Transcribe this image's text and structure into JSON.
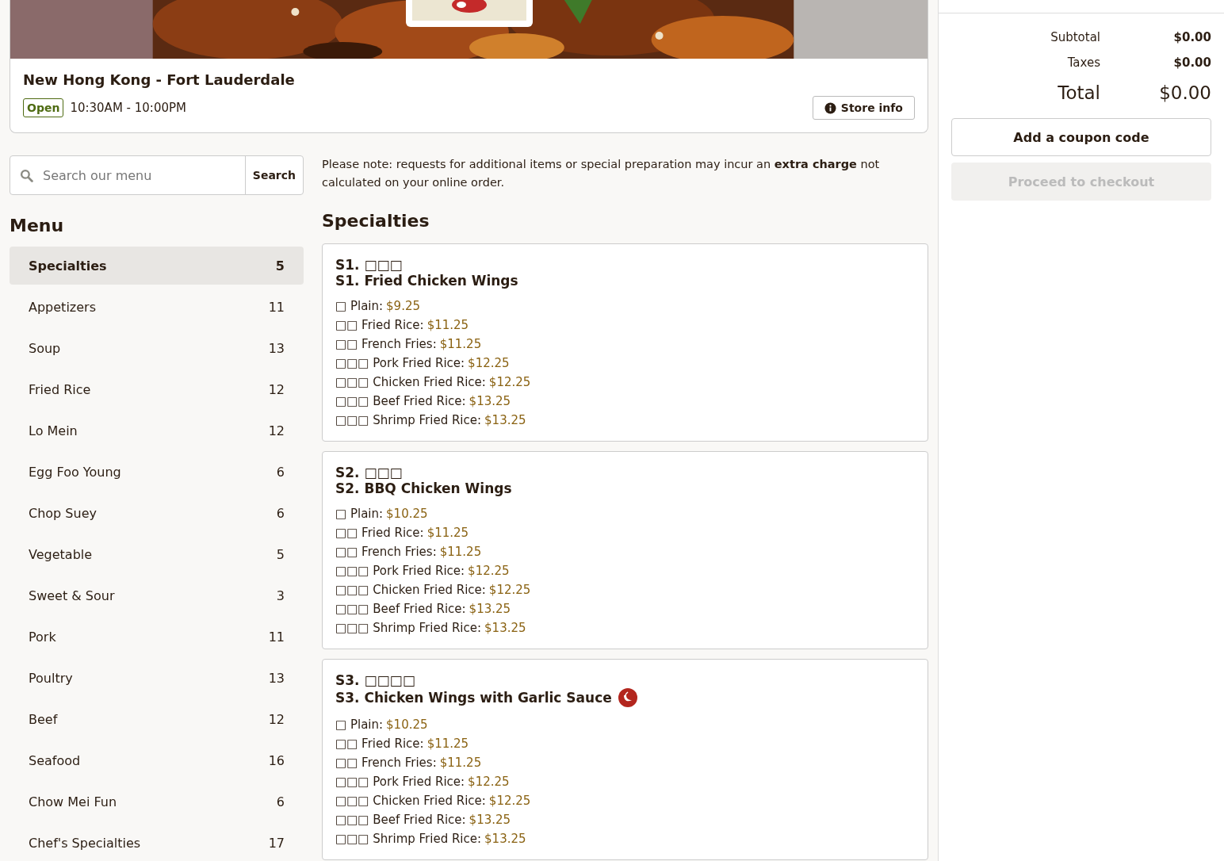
{
  "store": {
    "name": "New Hong Kong - Fort Lauderdale",
    "status": "Open",
    "hours": "10:30AM - 10:00PM",
    "info_button": "Store info"
  },
  "search": {
    "placeholder": "Search our menu",
    "button": "Search"
  },
  "menu": {
    "title": "Menu",
    "items": [
      {
        "label": "Specialties",
        "count": "5",
        "selected": true
      },
      {
        "label": "Appetizers",
        "count": "11",
        "selected": false
      },
      {
        "label": "Soup",
        "count": "13",
        "selected": false
      },
      {
        "label": "Fried Rice",
        "count": "12",
        "selected": false
      },
      {
        "label": "Lo Mein",
        "count": "12",
        "selected": false
      },
      {
        "label": "Egg Foo Young",
        "count": "6",
        "selected": false
      },
      {
        "label": "Chop Suey",
        "count": "6",
        "selected": false
      },
      {
        "label": "Vegetable",
        "count": "5",
        "selected": false
      },
      {
        "label": "Sweet & Sour",
        "count": "3",
        "selected": false
      },
      {
        "label": "Pork",
        "count": "11",
        "selected": false
      },
      {
        "label": "Poultry",
        "count": "13",
        "selected": false
      },
      {
        "label": "Beef",
        "count": "12",
        "selected": false
      },
      {
        "label": "Seafood",
        "count": "16",
        "selected": false
      },
      {
        "label": "Chow Mei Fun",
        "count": "6",
        "selected": false
      },
      {
        "label": "Chef's Specialties",
        "count": "17",
        "selected": false
      }
    ]
  },
  "notice": "Please note: requests for additional items or special preparation may incur an **extra charge** not calculated on your online order.",
  "section": {
    "title": "Specialties",
    "items": [
      {
        "native_name": "S1. □□□",
        "name": "S1. Fried Chicken Wings",
        "spicy": false,
        "options": [
          {
            "label": "□ Plain:",
            "price": "$9.25"
          },
          {
            "label": "□□ Fried Rice:",
            "price": "$11.25"
          },
          {
            "label": "□□ French Fries:",
            "price": "$11.25"
          },
          {
            "label": "□□□ Pork Fried Rice:",
            "price": "$12.25"
          },
          {
            "label": "□□□ Chicken Fried Rice:",
            "price": "$12.25"
          },
          {
            "label": "□□□ Beef Fried Rice:",
            "price": "$13.25"
          },
          {
            "label": "□□□ Shrimp Fried Rice:",
            "price": "$13.25"
          }
        ]
      },
      {
        "native_name": "S2. □□□",
        "name": "S2. BBQ Chicken Wings",
        "spicy": false,
        "options": [
          {
            "label": "□ Plain:",
            "price": "$10.25"
          },
          {
            "label": "□□ Fried Rice:",
            "price": "$11.25"
          },
          {
            "label": "□□ French Fries:",
            "price": "$11.25"
          },
          {
            "label": "□□□ Pork Fried Rice:",
            "price": "$12.25"
          },
          {
            "label": "□□□ Chicken Fried Rice:",
            "price": "$12.25"
          },
          {
            "label": "□□□ Beef Fried Rice:",
            "price": "$13.25"
          },
          {
            "label": "□□□ Shrimp Fried Rice:",
            "price": "$13.25"
          }
        ]
      },
      {
        "native_name": "S3. □□□□",
        "name": "S3. Chicken Wings with Garlic Sauce",
        "spicy": true,
        "options": [
          {
            "label": "□ Plain:",
            "price": "$10.25"
          },
          {
            "label": "□□ Fried Rice:",
            "price": "$11.25"
          },
          {
            "label": "□□ French Fries:",
            "price": "$11.25"
          },
          {
            "label": "□□□ Pork Fried Rice:",
            "price": "$12.25"
          },
          {
            "label": "□□□ Chicken Fried Rice:",
            "price": "$12.25"
          },
          {
            "label": "□□□ Beef Fried Rice:",
            "price": "$13.25"
          },
          {
            "label": "□□□ Shrimp Fried Rice:",
            "price": "$13.25"
          }
        ]
      }
    ]
  },
  "cart": {
    "rows": [
      {
        "kind": "minor",
        "label": "Subtotal",
        "value": "$0.00"
      },
      {
        "kind": "minor",
        "label": "Taxes",
        "value": "$0.00"
      },
      {
        "kind": "total",
        "label": "Total",
        "value": "$0.00"
      }
    ],
    "coupon_button": "Add a coupon code",
    "checkout_button": {
      "label": "Proceed to checkout",
      "disabled": true
    }
  }
}
